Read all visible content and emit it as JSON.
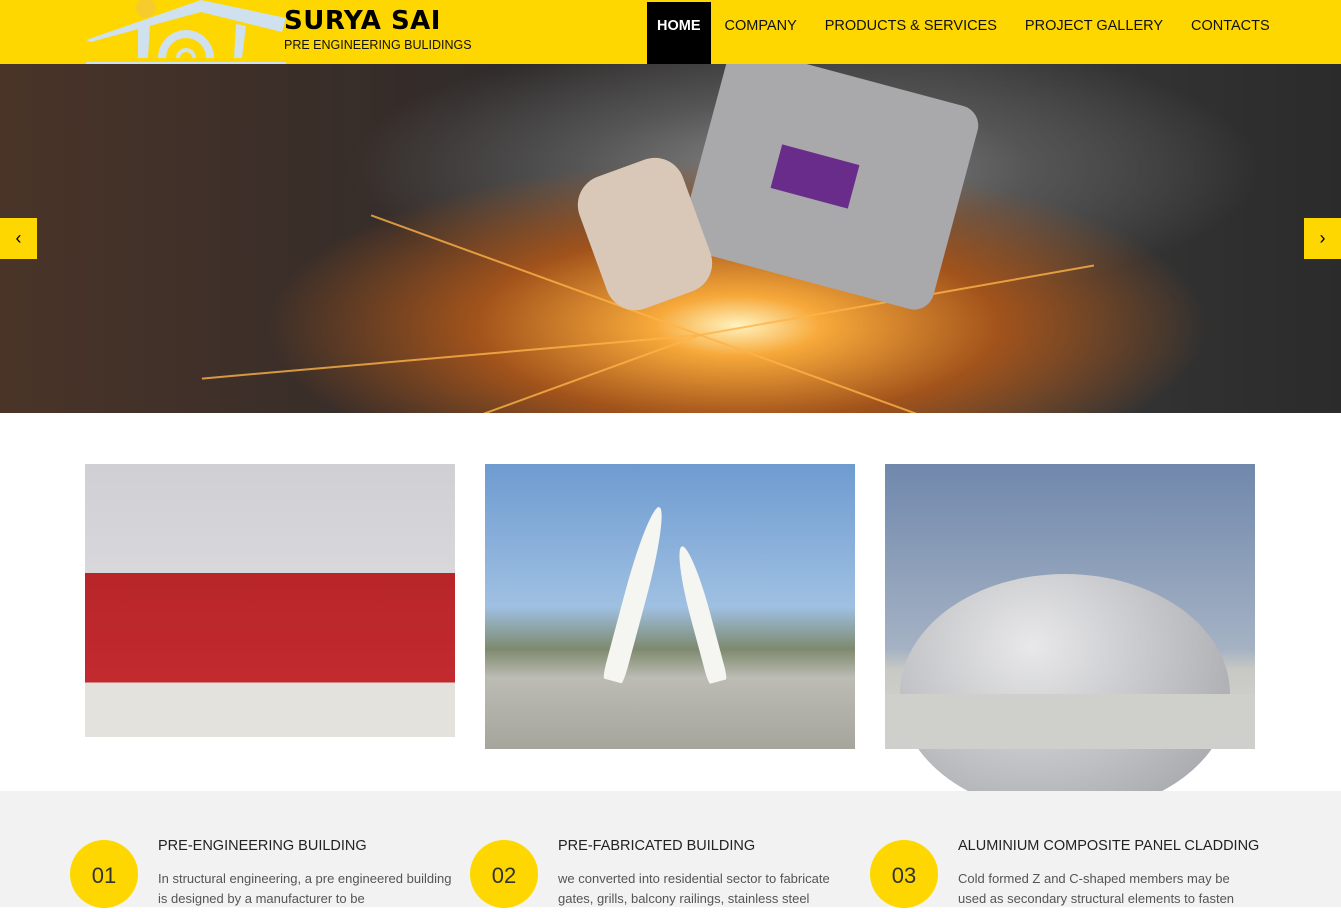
{
  "header": {
    "brand": "SURYA SAI",
    "tagline": "PRE ENGINEERING BULIDINGS",
    "accent": "#fed700"
  },
  "nav": [
    {
      "label": "HOME",
      "active": true
    },
    {
      "label": "COMPANY"
    },
    {
      "label": "PRODUCTS & SERVICES"
    },
    {
      "label": "PROJECT GALLERY"
    },
    {
      "label": "CONTACTS"
    }
  ],
  "slider": {
    "prev": "‹",
    "next": "›"
  },
  "features": [
    {
      "num": "01",
      "title": "PRE-ENGINEERING BUILDING",
      "text": "In structural engineering, a pre engineered building is designed by a manufacturer to be"
    },
    {
      "num": "02",
      "title": "PRE-FABRICATED BUILDING",
      "text": "we converted into residential sector to fabricate gates, grills, balcony railings, stainless steel"
    },
    {
      "num": "03",
      "title": "ALUMINIUM COMPOSITE PANEL CLADDING",
      "text": "Cold formed Z and C-shaped members may be used as secondary structural elements to fasten"
    }
  ]
}
